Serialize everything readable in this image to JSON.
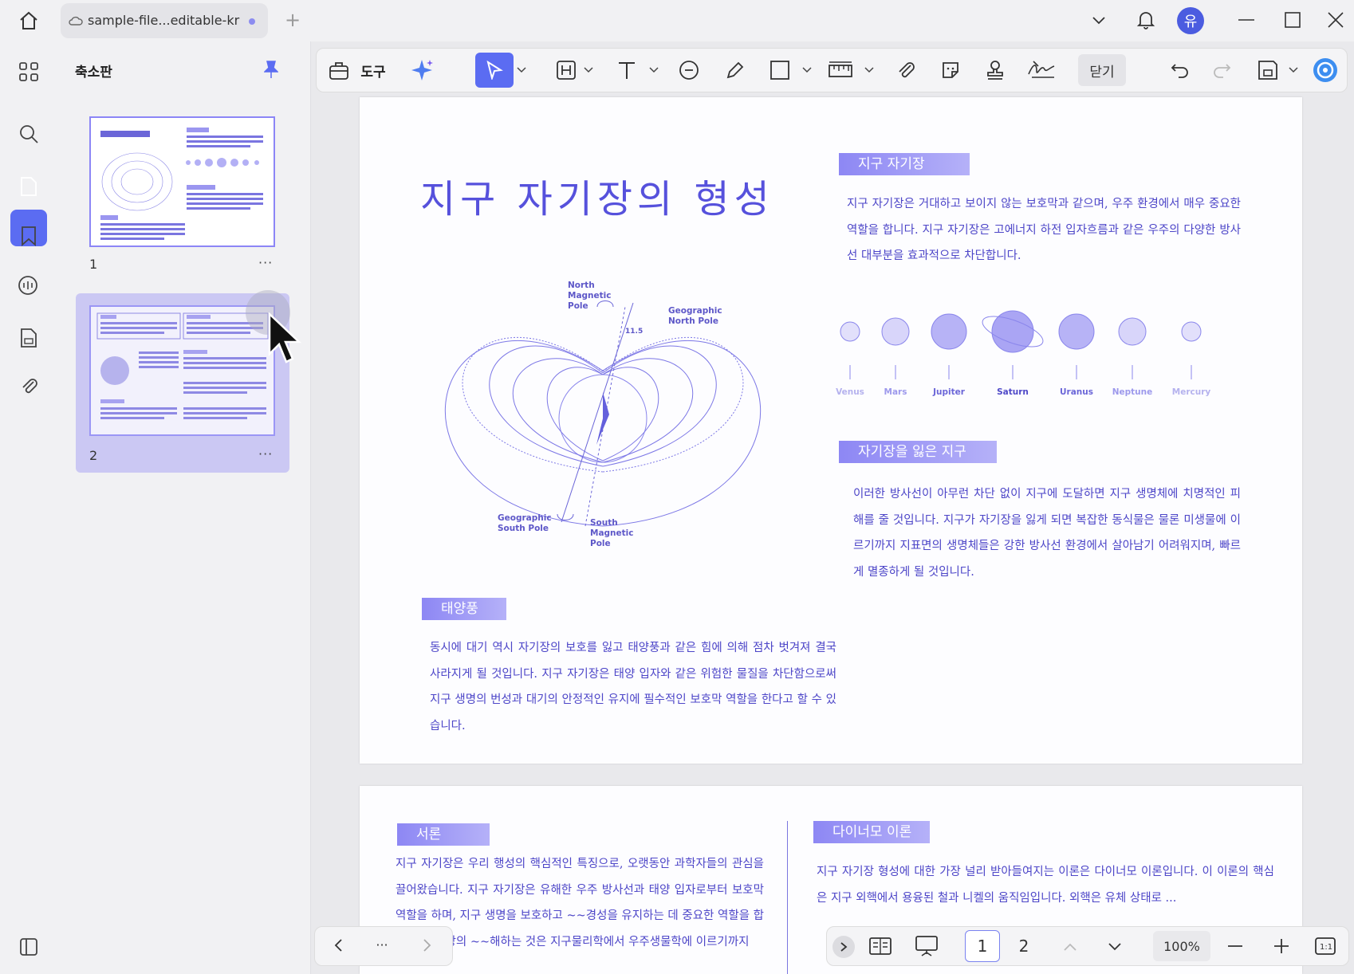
{
  "tab": {
    "title": "sample-file...editable-kr",
    "new_tab": "+"
  },
  "user": {
    "avatar_initial": "유"
  },
  "panel": {
    "title": "축소판",
    "pages": [
      {
        "label": "1",
        "more": "···"
      },
      {
        "label": "2",
        "more": "···"
      }
    ]
  },
  "toolbar": {
    "tools_label": "도구",
    "close_label": "닫기"
  },
  "page1": {
    "title": "지구 자기장의 형성",
    "sec1": {
      "heading": "지구 자기장",
      "body": "지구 자기장은 거대하고 보이지 않는 보호막과 같으며, 우주 환경에서 매우 중요한 역할을 합니다. 지구 자기장은 고에너지 하전 입자흐름과 같은 우주의 다양한 방사선 대부분을 효과적으로 차단합니다."
    },
    "sec2": {
      "heading": "자기장을 잃은 지구",
      "body": "이러한 방사선이 아무런 차단 없이 지구에 도달하면 지구 생명체에 치명적인 피해를 줄 것입니다. 지구가 자기장을 잃게 되면 복잡한 동식물은 물론 미생물에 이르기까지 지표면의 생명체들은 강한 방사선 환경에서 살아남기 어려워지며, 빠르게 멸종하게 될 것입니다."
    },
    "sec3": {
      "heading": "태양풍",
      "body": "동시에 대기 역시 자기장의 보호를 잃고 태양풍과 같은 힘에 의해 점차 벗겨져 결국 사라지게 될 것입니다. 지구 자기장은 태양 입자와 같은 위험한 물질을 차단함으로써 지구 생명의 번성과 대기의 안정적인 유지에 필수적인 보호막 역할을 한다고 할 수 있습니다."
    },
    "diagram": {
      "north_magnetic": "North Magnetic Pole",
      "geo_north": "Geographic North Pole",
      "geo_south": "Geographic South Pole",
      "south_magnetic": "South Magnetic Pole",
      "angle": "11.5"
    },
    "planets": [
      "Venus",
      "Mars",
      "Jupiter",
      "Saturn",
      "Uranus",
      "Neptune",
      "Mercury"
    ]
  },
  "page2": {
    "sec1": {
      "heading": "서론",
      "body": "지구 자기장은 우리 행성의 핵심적인 특징으로, 오랫동안 과학자들의 관심을 끌어왔습니다. 지구 자기장은 유해한 우주 방사선과 태양 입자로부터 보호막 역할을 하며, 지구 생명을 보호하고 ~~경성을 유지하는 데 중요한 역할을 합니다. 자기장의 ~~해하는 것은 지구물리학에서 우주생물학에 이르기까지"
    },
    "sec2": {
      "heading": "다이너모 이론",
      "body": "지구 자기장 형성에 대한 가장 널리 받아들여지는 이론은 다이너모 이론입니다. 이 이론의 핵심은 지구 외핵에서 용융된 철과 니켈의 움직임입니다. 외핵은 유체 상태로 ..."
    }
  },
  "bottom": {
    "more": "···",
    "page_1": "1",
    "page_2": "2",
    "zoom": "100%"
  }
}
